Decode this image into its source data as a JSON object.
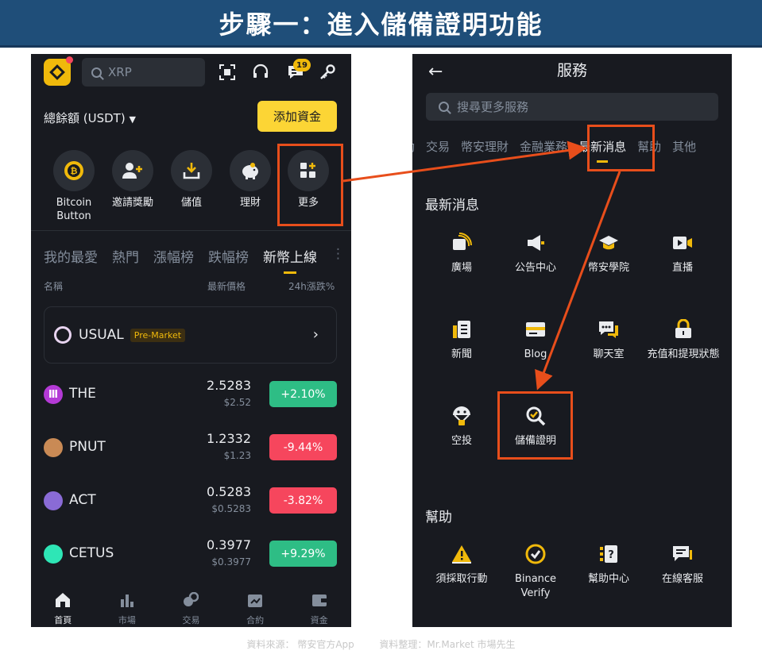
{
  "banner": {
    "title": "步驟一：進入儲備證明功能"
  },
  "left": {
    "search_text": "XRP",
    "notification_count": "19",
    "balance_label": "總餘額 (USDT)",
    "add_funds_label": "添加資金",
    "shortcuts": [
      {
        "label": "Bitcoin Button"
      },
      {
        "label": "邀請獎勵"
      },
      {
        "label": "儲值"
      },
      {
        "label": "理財"
      },
      {
        "label": "更多"
      }
    ],
    "market_tabs": [
      "我的最愛",
      "熱門",
      "漲幅榜",
      "跌幅榜",
      "新幣上線"
    ],
    "columns": {
      "name": "名稱",
      "price": "最新價格",
      "change": "24h漲跌%"
    },
    "featured": {
      "symbol": "USUAL",
      "tag": "Pre-Market"
    },
    "coins": [
      {
        "symbol": "THE",
        "price": "2.5283",
        "fiat": "$2.52",
        "change": "+2.10%",
        "direction": "up",
        "color": "#b43ad6"
      },
      {
        "symbol": "PNUT",
        "price": "1.2332",
        "fiat": "$1.23",
        "change": "-9.44%",
        "direction": "down",
        "color": "#c98a55"
      },
      {
        "symbol": "ACT",
        "price": "0.5283",
        "fiat": "$0.5283",
        "change": "-3.82%",
        "direction": "down",
        "color": "#8a6bd6"
      },
      {
        "symbol": "CETUS",
        "price": "0.3977",
        "fiat": "$0.3977",
        "change": "+9.29%",
        "direction": "up",
        "color": "#2ee6b6"
      }
    ],
    "nav": [
      "首頁",
      "市場",
      "交易",
      "合約",
      "資金"
    ]
  },
  "right": {
    "title": "服務",
    "search_placeholder": "搜尋更多服務",
    "tabs": [
      "動",
      "交易",
      "幣安理財",
      "金融業務",
      "最新消息",
      "幫助",
      "其他"
    ],
    "section_news": "最新消息",
    "news_items": [
      "廣場",
      "公告中心",
      "幣安學院",
      "直播",
      "新聞",
      "Blog",
      "聊天室",
      "充值和提現狀態",
      "空投",
      "儲備證明"
    ],
    "section_help": "幫助",
    "help_items": [
      "須採取行動",
      "Binance Verify",
      "幫助中心",
      "在線客服"
    ]
  },
  "footer": {
    "source": "資料來源： 幣安官方App",
    "credit": "資料整理：Mr.Market 市場先生"
  },
  "colors": {
    "accent": "#f0b90b",
    "up": "#2ebd85",
    "down": "#f6465d",
    "highlight": "#e84e1b",
    "banner": "#1f4e79"
  }
}
